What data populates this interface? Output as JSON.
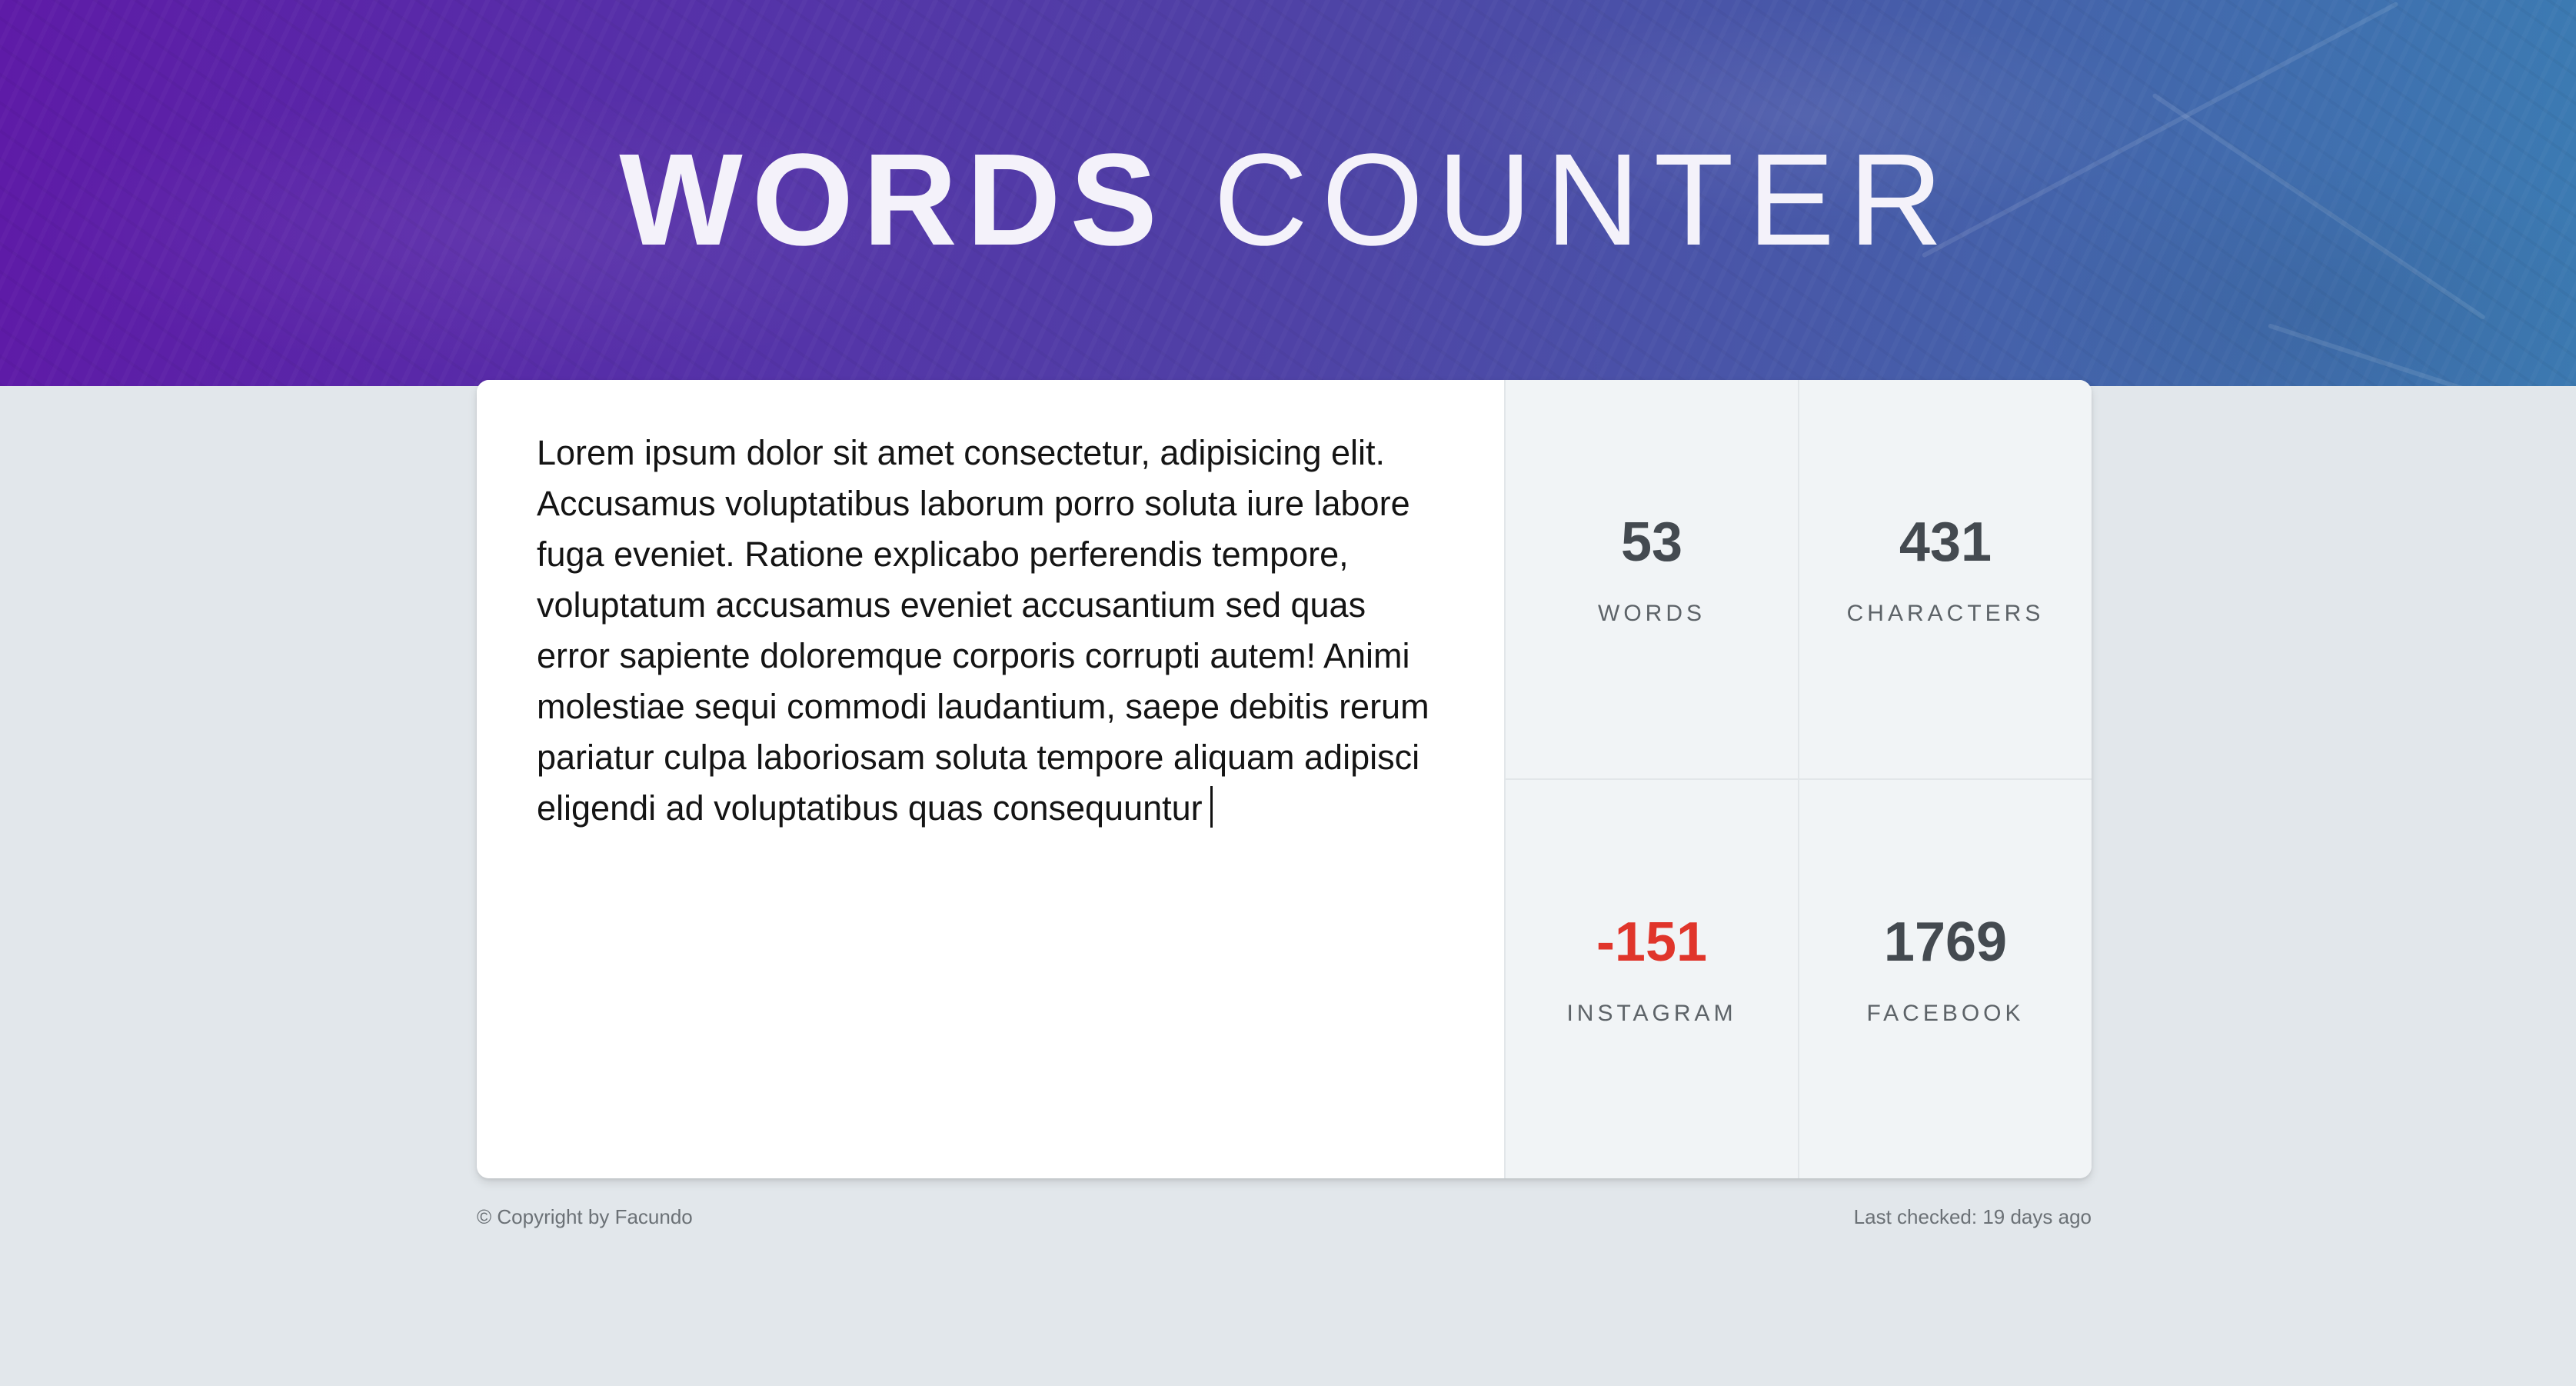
{
  "header": {
    "title_bold": "WORDS",
    "title_light": "COUNTER"
  },
  "editor": {
    "text": "Lorem ipsum dolor sit amet consectetur, adipisicing elit. Accusamus voluptatibus laborum porro soluta iure labore fuga eveniet. Ratione explicabo perferendis tempore, voluptatum accusamus eveniet accusantium sed quas error sapiente doloremque corporis corrupti autem! Animi molestiae sequi commodi laudantium, saepe debitis rerum pariatur culpa laboriosam soluta tempore aliquam adipisci eligendi ad voluptatibus quas consequuntur"
  },
  "stats": {
    "words": {
      "value": "53",
      "label": "WORDS"
    },
    "characters": {
      "value": "431",
      "label": "CHARACTERS"
    },
    "instagram": {
      "value": "-151",
      "label": "INSTAGRAM"
    },
    "facebook": {
      "value": "1769",
      "label": "FACEBOOK"
    }
  },
  "colors": {
    "negative": "#e0352b",
    "hero_start": "#5e1ba7",
    "hero_end": "#3c7ab2"
  },
  "footer": {
    "copyright": "© Copyright by Facundo",
    "last_checked": "Last checked: 19 days ago"
  }
}
